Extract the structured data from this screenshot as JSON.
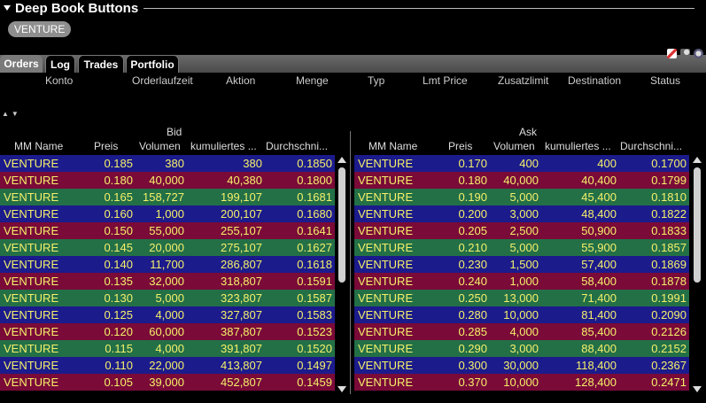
{
  "window": {
    "title": "Deep Book Buttons"
  },
  "symbol": "VENTURE",
  "tabs": [
    {
      "label": "Orders",
      "active": true
    },
    {
      "label": "Log",
      "active": false
    },
    {
      "label": "Trades",
      "active": false
    },
    {
      "label": "Portfolio",
      "active": false
    }
  ],
  "order_columns": [
    "Konto",
    "Orderlaufzeit",
    "Aktion",
    "Menge",
    "Typ",
    "Lmt Price",
    "Zusatzlimit",
    "Destination",
    "Status"
  ],
  "bid": {
    "group_label": "Bid",
    "headers": [
      "MM Name",
      "Preis",
      "Volumen",
      "kumuliertes ...",
      "Durchschni..."
    ],
    "rows": [
      {
        "mm": "VENTURE",
        "price": "0.185",
        "volume": "380",
        "cum": "380",
        "avg": "0.1850",
        "color": "blue"
      },
      {
        "mm": "VENTURE",
        "price": "0.180",
        "volume": "40,000",
        "cum": "40,380",
        "avg": "0.1800",
        "color": "red"
      },
      {
        "mm": "VENTURE",
        "price": "0.165",
        "volume": "158,727",
        "cum": "199,107",
        "avg": "0.1681",
        "color": "green"
      },
      {
        "mm": "VENTURE",
        "price": "0.160",
        "volume": "1,000",
        "cum": "200,107",
        "avg": "0.1680",
        "color": "blue"
      },
      {
        "mm": "VENTURE",
        "price": "0.150",
        "volume": "55,000",
        "cum": "255,107",
        "avg": "0.1641",
        "color": "red"
      },
      {
        "mm": "VENTURE",
        "price": "0.145",
        "volume": "20,000",
        "cum": "275,107",
        "avg": "0.1627",
        "color": "green"
      },
      {
        "mm": "VENTURE",
        "price": "0.140",
        "volume": "11,700",
        "cum": "286,807",
        "avg": "0.1618",
        "color": "blue"
      },
      {
        "mm": "VENTURE",
        "price": "0.135",
        "volume": "32,000",
        "cum": "318,807",
        "avg": "0.1591",
        "color": "red"
      },
      {
        "mm": "VENTURE",
        "price": "0.130",
        "volume": "5,000",
        "cum": "323,807",
        "avg": "0.1587",
        "color": "green"
      },
      {
        "mm": "VENTURE",
        "price": "0.125",
        "volume": "4,000",
        "cum": "327,807",
        "avg": "0.1583",
        "color": "blue"
      },
      {
        "mm": "VENTURE",
        "price": "0.120",
        "volume": "60,000",
        "cum": "387,807",
        "avg": "0.1523",
        "color": "red"
      },
      {
        "mm": "VENTURE",
        "price": "0.115",
        "volume": "4,000",
        "cum": "391,807",
        "avg": "0.1520",
        "color": "green"
      },
      {
        "mm": "VENTURE",
        "price": "0.110",
        "volume": "22,000",
        "cum": "413,807",
        "avg": "0.1497",
        "color": "blue"
      },
      {
        "mm": "VENTURE",
        "price": "0.105",
        "volume": "39,000",
        "cum": "452,807",
        "avg": "0.1459",
        "color": "red"
      }
    ]
  },
  "ask": {
    "group_label": "Ask",
    "headers": [
      "MM Name",
      "Preis",
      "Volumen",
      "kumuliertes ...",
      "Durchschni..."
    ],
    "rows": [
      {
        "mm": "VENTURE",
        "price": "0.170",
        "volume": "400",
        "cum": "400",
        "avg": "0.1700",
        "color": "blue"
      },
      {
        "mm": "VENTURE",
        "price": "0.180",
        "volume": "40,000",
        "cum": "40,400",
        "avg": "0.1799",
        "color": "red"
      },
      {
        "mm": "VENTURE",
        "price": "0.190",
        "volume": "5,000",
        "cum": "45,400",
        "avg": "0.1810",
        "color": "green"
      },
      {
        "mm": "VENTURE",
        "price": "0.200",
        "volume": "3,000",
        "cum": "48,400",
        "avg": "0.1822",
        "color": "blue"
      },
      {
        "mm": "VENTURE",
        "price": "0.205",
        "volume": "2,500",
        "cum": "50,900",
        "avg": "0.1833",
        "color": "red"
      },
      {
        "mm": "VENTURE",
        "price": "0.210",
        "volume": "5,000",
        "cum": "55,900",
        "avg": "0.1857",
        "color": "green"
      },
      {
        "mm": "VENTURE",
        "price": "0.230",
        "volume": "1,500",
        "cum": "57,400",
        "avg": "0.1869",
        "color": "blue"
      },
      {
        "mm": "VENTURE",
        "price": "0.240",
        "volume": "1,000",
        "cum": "58,400",
        "avg": "0.1878",
        "color": "red"
      },
      {
        "mm": "VENTURE",
        "price": "0.250",
        "volume": "13,000",
        "cum": "71,400",
        "avg": "0.1991",
        "color": "green"
      },
      {
        "mm": "VENTURE",
        "price": "0.280",
        "volume": "10,000",
        "cum": "81,400",
        "avg": "0.2090",
        "color": "blue"
      },
      {
        "mm": "VENTURE",
        "price": "0.285",
        "volume": "4,000",
        "cum": "85,400",
        "avg": "0.2126",
        "color": "red"
      },
      {
        "mm": "VENTURE",
        "price": "0.290",
        "volume": "3,000",
        "cum": "88,400",
        "avg": "0.2152",
        "color": "green"
      },
      {
        "mm": "VENTURE",
        "price": "0.300",
        "volume": "30,000",
        "cum": "118,400",
        "avg": "0.2367",
        "color": "blue"
      },
      {
        "mm": "VENTURE",
        "price": "0.370",
        "volume": "10,000",
        "cum": "128,400",
        "avg": "0.2471",
        "color": "red"
      }
    ]
  },
  "colors": {
    "blue": "#1b1b8c",
    "red": "#7a0a38",
    "green": "#237047",
    "text": "#f5f06a"
  }
}
